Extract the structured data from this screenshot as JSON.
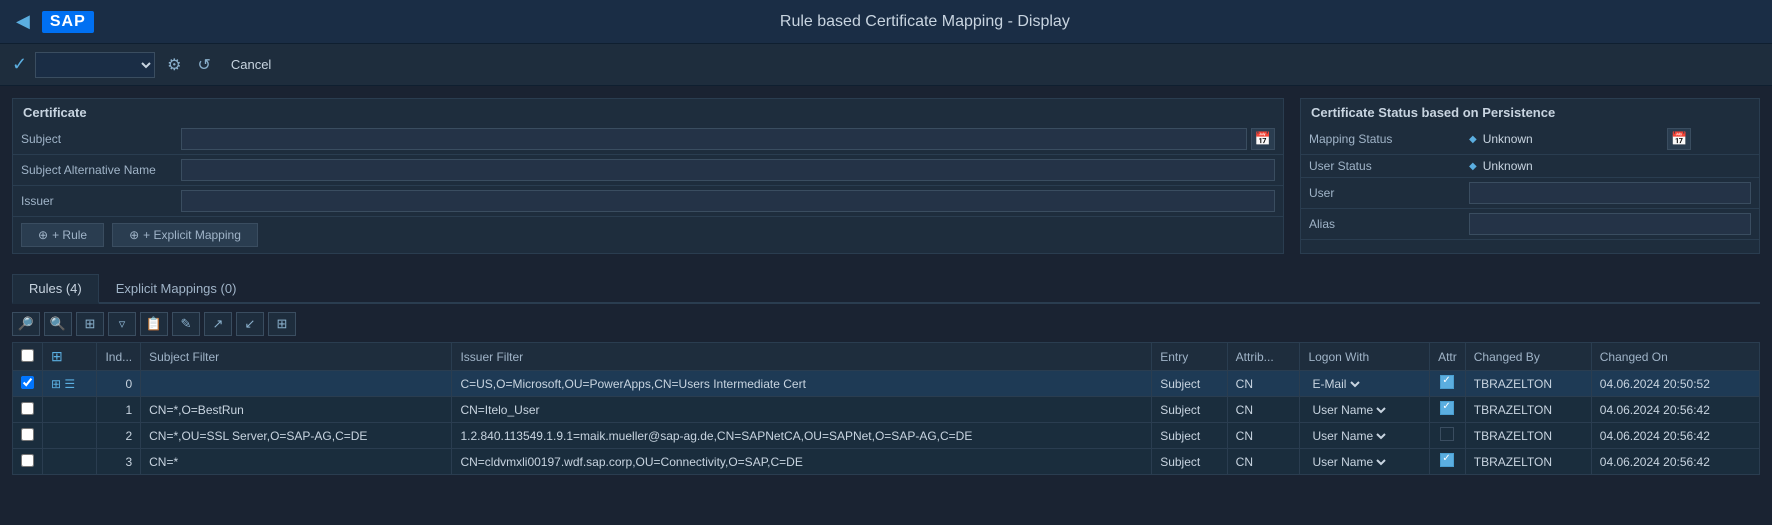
{
  "header": {
    "title": "Rule based Certificate Mapping - Display",
    "back_label": "◀",
    "sap_logo": "SAP"
  },
  "toolbar": {
    "check_icon": "✓",
    "dropdown_placeholder": "",
    "refresh_icon": "⟳",
    "sync_icon": "↺",
    "cancel_label": "Cancel"
  },
  "certificate_section": {
    "title": "Certificate",
    "fields": [
      {
        "label": "Subject",
        "value": ""
      },
      {
        "label": "Subject Alternative Name",
        "value": ""
      },
      {
        "label": "Issuer",
        "value": ""
      }
    ],
    "buttons": [
      {
        "label": "+ Rule",
        "id": "rule-btn"
      },
      {
        "label": "+ Explicit Mapping",
        "id": "explicit-mapping-btn"
      }
    ]
  },
  "status_section": {
    "title": "Certificate Status based on Persistence",
    "fields": [
      {
        "label": "Mapping Status",
        "value": "Unknown",
        "has_dot": true
      },
      {
        "label": "User Status",
        "value": "Unknown",
        "has_dot": true
      },
      {
        "label": "User",
        "value": ""
      },
      {
        "label": "Alias",
        "value": ""
      }
    ]
  },
  "tabs": [
    {
      "label": "Rules (4)",
      "active": true
    },
    {
      "label": "Explicit Mappings (0)",
      "active": false
    }
  ],
  "table_toolbar_icons": [
    "🔍",
    "🔎",
    "⊞",
    "▽",
    "📋",
    "🖊",
    "↗",
    "↙",
    "⊡"
  ],
  "table": {
    "columns": [
      {
        "label": "",
        "id": "checkbox-col"
      },
      {
        "label": "",
        "id": "grid-col"
      },
      {
        "label": "Ind...",
        "id": "index-col"
      },
      {
        "label": "Subject Filter",
        "id": "subject-filter-col"
      },
      {
        "label": "Issuer Filter",
        "id": "issuer-filter-col"
      },
      {
        "label": "Entry",
        "id": "entry-col"
      },
      {
        "label": "Attrib...",
        "id": "attrib-col"
      },
      {
        "label": "Logon With",
        "id": "logon-with-col"
      },
      {
        "label": "Attr",
        "id": "attr-col"
      },
      {
        "label": "Changed By",
        "id": "changed-by-col"
      },
      {
        "label": "Changed On",
        "id": "changed-on-col"
      }
    ],
    "rows": [
      {
        "selected": true,
        "index": "0",
        "subject_filter": "",
        "subject_filter_special": true,
        "issuer_filter": "C=US,O=Microsoft,OU=PowerApps,CN=Users Intermediate Cert",
        "entry": "Subject",
        "attrib": "CN",
        "logon_with": "E-Mail",
        "logon_with_dropdown": true,
        "attr_checked": true,
        "changed_by": "TBRAZELTON",
        "changed_on": "04.06.2024 20:50:52"
      },
      {
        "selected": false,
        "index": "1",
        "subject_filter": "CN=*,O=BestRun",
        "issuer_filter": "CN=Itelo_User",
        "entry": "Subject",
        "attrib": "CN",
        "logon_with": "User Name",
        "logon_with_dropdown": true,
        "attr_checked": true,
        "changed_by": "TBRAZELTON",
        "changed_on": "04.06.2024 20:56:42"
      },
      {
        "selected": false,
        "index": "2",
        "subject_filter": "CN=*,OU=SSL Server,O=SAP-AG,C=DE",
        "issuer_filter": "1.2.840.113549.1.9.1=maik.mueller@sap-ag.de,CN=SAPNetCA,OU=SAPNet,O=SAP-AG,C=DE",
        "entry": "Subject",
        "attrib": "CN",
        "logon_with": "User Name",
        "logon_with_dropdown": true,
        "attr_checked": false,
        "changed_by": "TBRAZELTON",
        "changed_on": "04.06.2024 20:56:42"
      },
      {
        "selected": false,
        "index": "3",
        "subject_filter": "CN=*",
        "issuer_filter": "CN=cldvmxli00197.wdf.sap.corp,OU=Connectivity,O=SAP,C=DE",
        "entry": "Subject",
        "attrib": "CN",
        "logon_with": "User Name",
        "logon_with_dropdown": true,
        "attr_checked": true,
        "changed_by": "TBRAZELTON",
        "changed_on": "04.06.2024 20:56:42"
      }
    ]
  },
  "colors": {
    "accent": "#5baee0",
    "bg_dark": "#1a2332",
    "bg_medium": "#1e2d3d",
    "border": "#2a3d50"
  }
}
